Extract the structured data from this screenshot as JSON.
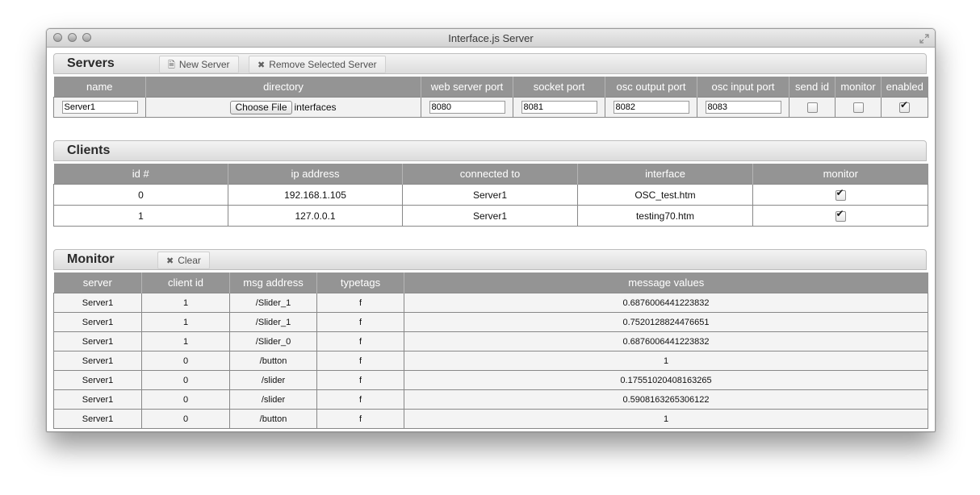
{
  "window": {
    "title": "Interface.js Server"
  },
  "servers": {
    "title": "Servers",
    "new_button": "New Server",
    "remove_button": "Remove Selected Server",
    "columns": [
      "name",
      "directory",
      "web server port",
      "socket port",
      "osc output port",
      "osc input port",
      "send id",
      "monitor",
      "enabled"
    ],
    "rows": [
      {
        "name": "Server1",
        "choose_file_label": "Choose File",
        "directory": "interfaces",
        "web_server_port": "8080",
        "socket_port": "8081",
        "osc_output_port": "8082",
        "osc_input_port": "8083",
        "send_id": false,
        "monitor": false,
        "enabled": true
      }
    ]
  },
  "clients": {
    "title": "Clients",
    "columns": [
      "id #",
      "ip address",
      "connected to",
      "interface",
      "monitor"
    ],
    "rows": [
      {
        "id": "0",
        "ip": "192.168.1.105",
        "connected_to": "Server1",
        "interface": "OSC_test.htm",
        "monitor": true
      },
      {
        "id": "1",
        "ip": "127.0.0.1",
        "connected_to": "Server1",
        "interface": "testing70.htm",
        "monitor": true
      }
    ]
  },
  "monitor": {
    "title": "Monitor",
    "clear_button": "Clear",
    "columns": [
      "server",
      "client id",
      "msg address",
      "typetags",
      "message values"
    ],
    "rows": [
      [
        "Server1",
        "1",
        "/Slider_1",
        "f",
        "0.6876006441223832"
      ],
      [
        "Server1",
        "1",
        "/Slider_1",
        "f",
        "0.7520128824476651"
      ],
      [
        "Server1",
        "1",
        "/Slider_0",
        "f",
        "0.6876006441223832"
      ],
      [
        "Server1",
        "0",
        "/button",
        "f",
        "1"
      ],
      [
        "Server1",
        "0",
        "/slider",
        "f",
        "0.17551020408163265"
      ],
      [
        "Server1",
        "0",
        "/slider",
        "f",
        "0.5908163265306122"
      ],
      [
        "Server1",
        "0",
        "/button",
        "f",
        "1"
      ]
    ]
  }
}
